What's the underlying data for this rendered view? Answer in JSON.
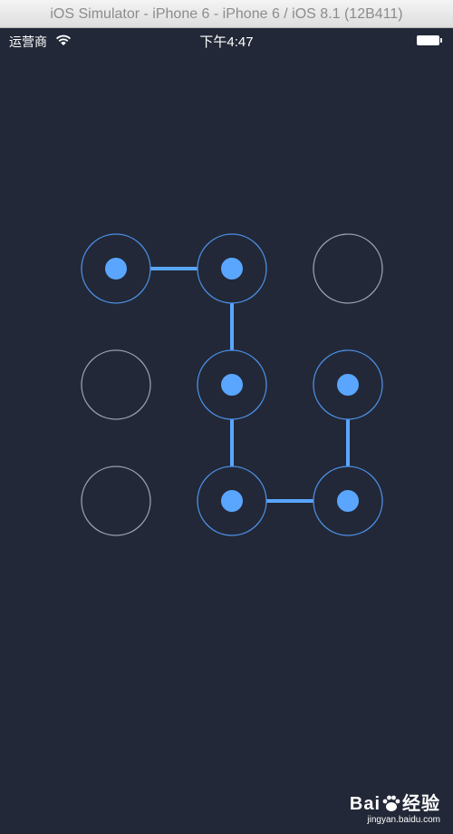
{
  "window": {
    "title": "iOS Simulator - iPhone 6 - iPhone 6 / iOS 8.1 (12B411)"
  },
  "status_bar": {
    "carrier": "运营商",
    "time": "下午4:47",
    "wifi_icon": "wifi-icon",
    "battery_icon": "battery-icon"
  },
  "colors": {
    "background": "#222837",
    "accent": "#5aa6ff",
    "ring_inactive": "#9aa0ab",
    "ring_active": "#4c8fe6"
  },
  "pattern_lock": {
    "rows": 3,
    "cols": 3,
    "nodes": [
      {
        "id": 1,
        "selected": true
      },
      {
        "id": 2,
        "selected": true
      },
      {
        "id": 3,
        "selected": false
      },
      {
        "id": 4,
        "selected": false
      },
      {
        "id": 5,
        "selected": true
      },
      {
        "id": 6,
        "selected": true
      },
      {
        "id": 7,
        "selected": false
      },
      {
        "id": 8,
        "selected": true
      },
      {
        "id": 9,
        "selected": true
      }
    ],
    "path": [
      1,
      2,
      5,
      8,
      9,
      6
    ]
  },
  "watermark": {
    "brand_prefix": "Bai",
    "brand_suffix": "经验",
    "url": "jingyan.baidu.com"
  }
}
